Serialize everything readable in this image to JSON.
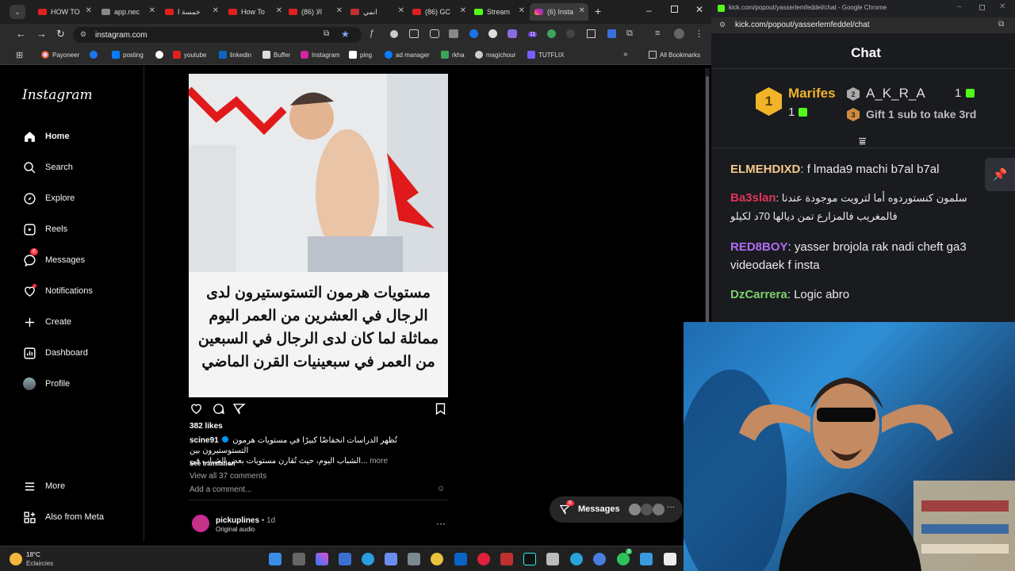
{
  "browser": {
    "tabs": [
      {
        "label": "HOW TO",
        "active": false
      },
      {
        "label": "app.nec",
        "active": false
      },
      {
        "label": "خمسة ا",
        "active": false
      },
      {
        "label": "How To",
        "active": false
      },
      {
        "label": "(86) الا",
        "active": false
      },
      {
        "label": "انمي",
        "active": false
      },
      {
        "label": "(86) GC",
        "active": false
      },
      {
        "label": "Stream",
        "active": false
      },
      {
        "label": "(6) Insta",
        "active": true
      }
    ],
    "url": "instagram.com",
    "bookmarks": [
      "Payoneer",
      "posting",
      "youtube",
      "linkedin",
      "Buffer",
      "Instagram",
      "ping",
      "ad manager",
      "rkha",
      "magichour",
      "TUTFLIX"
    ],
    "all_bookmarks": "All Bookmarks",
    "ext_badge": "11"
  },
  "instagram": {
    "logo": "Instagram",
    "nav": [
      {
        "label": "Home",
        "icon": "home-icon"
      },
      {
        "label": "Search",
        "icon": "search-icon"
      },
      {
        "label": "Explore",
        "icon": "compass-icon"
      },
      {
        "label": "Reels",
        "icon": "reels-icon"
      },
      {
        "label": "Messages",
        "icon": "messenger-icon",
        "badge": "6"
      },
      {
        "label": "Notifications",
        "icon": "heart-icon"
      },
      {
        "label": "Create",
        "icon": "plus-icon"
      },
      {
        "label": "Dashboard",
        "icon": "dashboard-icon"
      },
      {
        "label": "Profile",
        "icon": "avatar"
      }
    ],
    "more": "More",
    "also_meta": "Also from Meta",
    "post": {
      "overlay_lines": [
        "مستويات هرمون التستوستيرون لدى",
        "الرجال في العشرين من العمر اليوم",
        "مماثلة لما كان لدى الرجال في السبعين",
        "من العمر في سبعينيات القرن الماضي"
      ],
      "likes": "382 likes",
      "username": "scine91",
      "caption_line1": "تُظهر الدراسات انخفاضًا كبيرًا في مستويات هرمون التستوستيرون بين",
      "caption_line2": "الشباب اليوم، حيث تُقارن مستويات بعض الشباب في...",
      "more": "more",
      "see_translation": "See translation",
      "view_comments": "View all 37 comments",
      "add_comment": "Add a comment..."
    },
    "next_post": {
      "username": "pickuplines",
      "time": "• 1d",
      "audio": "Original audio"
    },
    "messages_pill": {
      "label": "Messages",
      "badge": "6"
    }
  },
  "chat": {
    "window_url_title": "kick.com/popout/yasserlemfeddel/chat - Google Chrome",
    "url": "kick.com/popout/yasserlemfeddel/chat",
    "title": "Chat",
    "leaderboard": {
      "first": {
        "rank": "1",
        "name": "Marifes",
        "count": "1"
      },
      "second": {
        "rank": "2",
        "name": "A_K_R_A",
        "count": "1"
      },
      "third": {
        "rank": "3",
        "text": "Gift 1 sub to take 3rd"
      }
    },
    "messages": [
      {
        "user": "ELMEHDIXD",
        "color": "#f5c98a",
        "text": "f lmada9 machi b7al b7al"
      },
      {
        "user": "Ba3slan",
        "color": "#e0345a",
        "text": "سلمون كنستوردوه أما لترويت موجودة عندنا فالمغريب فالمزارع تمن ديالها 70د لكيلو"
      },
      {
        "user": "RED8BOY",
        "color": "#b06cf2",
        "text": "yasser brojola rak nadi cheft ga3 videodaek f insta"
      },
      {
        "user": "DzCarrera",
        "color": "#7bd36b",
        "text": "Logic abro"
      }
    ]
  },
  "taskbar": {
    "temp": "18°C",
    "weather": "Eclaircies",
    "notif_badge": "3"
  },
  "colors": {
    "ig_bg": "#000000",
    "chat_bg": "#191b1f",
    "kick_green": "#53fc18",
    "gold": "#f0b429"
  }
}
